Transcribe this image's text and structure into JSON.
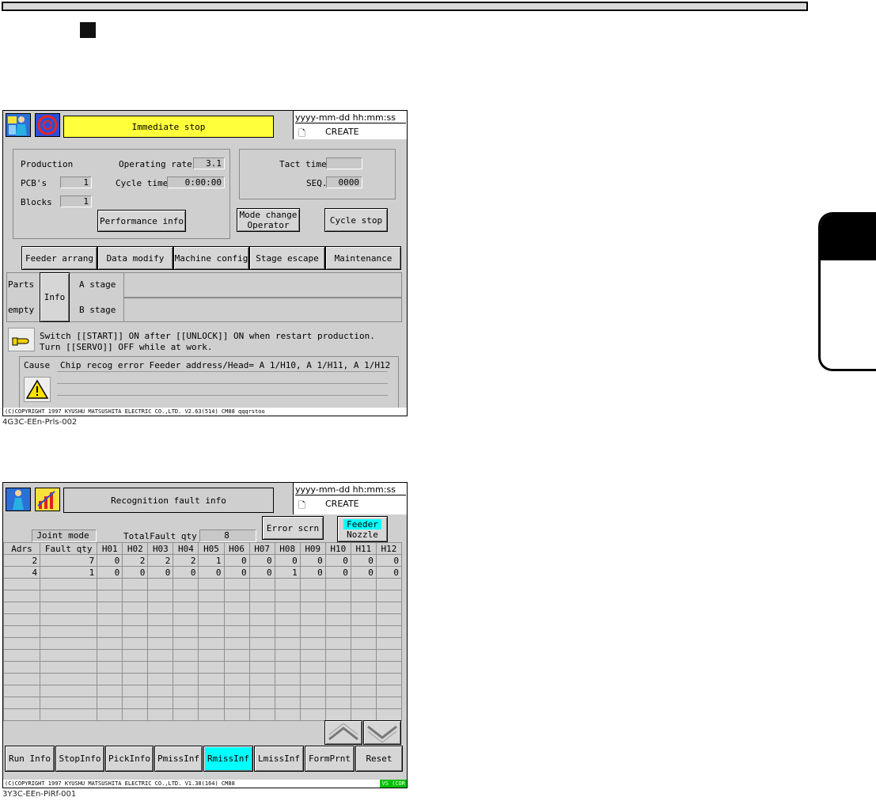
{
  "screen1": {
    "datetime": "yyyy-mm-dd  hh:mm:ss",
    "mode": "CREATE",
    "title": "Immediate stop",
    "production_label": "Production",
    "pcbs_label": "PCB's",
    "pcbs_value": "1",
    "blocks_label": "Blocks",
    "blocks_value": "1",
    "operating_rate_label": "Operating rate",
    "operating_rate_value": "3.1",
    "cycle_time_label": "Cycle time",
    "cycle_time_value": "0:00:00",
    "tact_time_label": "Tact time",
    "tact_time_value": "",
    "seq_label": "SEQ.",
    "seq_value": "0000",
    "performance_btn": "Performance info",
    "mode_change_btn_1": "Mode change",
    "mode_change_btn_2": "Operator",
    "cycle_stop_btn": "Cycle stop",
    "tabs": [
      "Feeder arrang",
      "Data modify",
      "Machine config",
      "Stage escape",
      "Maintenance"
    ],
    "parts_label": "Parts",
    "empty_label": "empty",
    "info_btn": "Info",
    "a_stage": "A stage",
    "b_stage": "B stage",
    "message_1": "Switch [[START]] ON after [[UNLOCK]] ON when restart production.",
    "message_2": "Turn [[SERVO]] OFF while at work.",
    "cause_label": "Cause",
    "cause_text": "Chip recog error Feeder address/Head= A 1/H10, A 1/H11, A 1/H12",
    "copyright": "(C)COPYRIGHT 1997 KYUSHU MATSUSHITA ELECTRIC CO.,LTD. V2.63(514)    CM88                  qqqrstoo",
    "caption": "4G3C-EEn-Prls-002"
  },
  "screen2": {
    "datetime": "yyyy-mm-dd  hh:mm:ss",
    "mode": "CREATE",
    "title": "Recognition fault info",
    "joint_mode": "Joint mode",
    "total_fault_label": "TotalFault qty",
    "total_fault_value": "8",
    "error_scrn_btn": "Error scrn",
    "feeder_label": "Feeder",
    "nozzle_label": "Nozzle",
    "columns": [
      "Adrs",
      "Fault qty",
      "H01",
      "H02",
      "H03",
      "H04",
      "H05",
      "H06",
      "H07",
      "H08",
      "H09",
      "H10",
      "H11",
      "H12"
    ],
    "rows": [
      [
        "2",
        "7",
        "0",
        "2",
        "2",
        "2",
        "1",
        "0",
        "0",
        "0",
        "0",
        "0",
        "0",
        "0"
      ],
      [
        "4",
        "1",
        "0",
        "0",
        "0",
        "0",
        "0",
        "0",
        "0",
        "1",
        "0",
        "0",
        "0",
        "0"
      ]
    ],
    "bottom_buttons": [
      "Run Info",
      "StopInfo",
      "PickInfo",
      "PmissInf",
      "RmissInf",
      "LmissInf",
      "FormPrnt",
      "Reset"
    ],
    "active_button": "RmissInf",
    "copyright": "(C)COPYRIGHT 1997 KYUSHU MATSUSHITA ELECTRIC CO.,LTD. V1.38(164)    CM88",
    "status_tag": "VS (COR",
    "caption": "3Y3C-EEn-PiRf-001"
  },
  "colors": {
    "title_yellow": "#ffff3c",
    "highlight_cyan": "#00ffff",
    "screen_gray": "#cfcfcf",
    "icon_blue": "#1a5fd6"
  }
}
